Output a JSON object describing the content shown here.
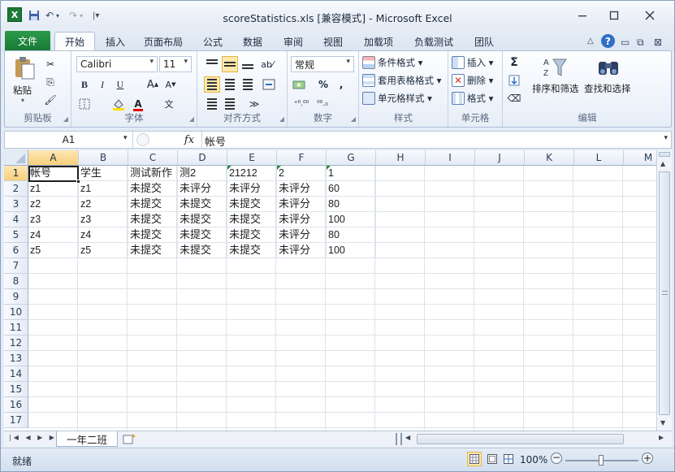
{
  "window": {
    "title": "scoreStatistics.xls  [兼容模式]  -  Microsoft Excel"
  },
  "ribbon_tabs": [
    "文件",
    "开始",
    "插入",
    "页面布局",
    "公式",
    "数据",
    "审阅",
    "视图",
    "加载项",
    "负载测试",
    "团队"
  ],
  "ribbon": {
    "clipboard": {
      "label": "剪贴板",
      "paste": "粘贴"
    },
    "font": {
      "label": "字体",
      "name": "Calibri",
      "size": "11",
      "bold": "B",
      "italic": "I",
      "underline": "U"
    },
    "alignment": {
      "label": "对齐方式"
    },
    "number": {
      "label": "数字",
      "format": "常规",
      "percent": "%",
      "comma": ",",
      "inc_decimal": "⁺⁰.⁰⁰",
      "dec_decimal": "⁰⁰.₀"
    },
    "styles": {
      "label": "样式",
      "conditional": "条件格式",
      "table": "套用表格格式",
      "cell": "单元格样式"
    },
    "cells": {
      "label": "单元格",
      "insert": "插入",
      "delete": "删除",
      "format": "格式"
    },
    "editing": {
      "label": "编辑",
      "sum": "Σ",
      "sort_filter": "排序和筛选",
      "find_select": "查找和选择"
    }
  },
  "formula_bar": {
    "name_box": "A1",
    "fx": "fx",
    "value": "帐号"
  },
  "columns": [
    "A",
    "B",
    "C",
    "D",
    "E",
    "F",
    "G",
    "H",
    "I",
    "J",
    "K",
    "L",
    "M"
  ],
  "rows": [
    "1",
    "2",
    "3",
    "4",
    "5",
    "6",
    "7",
    "8",
    "9",
    "10",
    "11",
    "12",
    "13",
    "14",
    "15",
    "16",
    "17"
  ],
  "cells": [
    [
      "帐号",
      "学生",
      "测试新作",
      "测2",
      "21212",
      "2",
      "1"
    ],
    [
      "z1",
      "z1",
      "未提交",
      "未评分",
      "未评分",
      "未评分",
      "60"
    ],
    [
      "z2",
      "z2",
      "未提交",
      "未提交",
      "未提交",
      "未评分",
      "80"
    ],
    [
      "z3",
      "z3",
      "未提交",
      "未提交",
      "未提交",
      "未评分",
      "100"
    ],
    [
      "z4",
      "z4",
      "未提交",
      "未提交",
      "未提交",
      "未评分",
      "80"
    ],
    [
      "z5",
      "z5",
      "未提交",
      "未提交",
      "未提交",
      "未评分",
      "100"
    ]
  ],
  "sheet_tabs": [
    "一年二班"
  ],
  "status": {
    "ready": "就绪",
    "zoom": "100%"
  },
  "colors": {
    "file_tab": "#1f8a3c",
    "ribbon_bg": "#e7eef8",
    "header_active": "#f8cf7a"
  }
}
